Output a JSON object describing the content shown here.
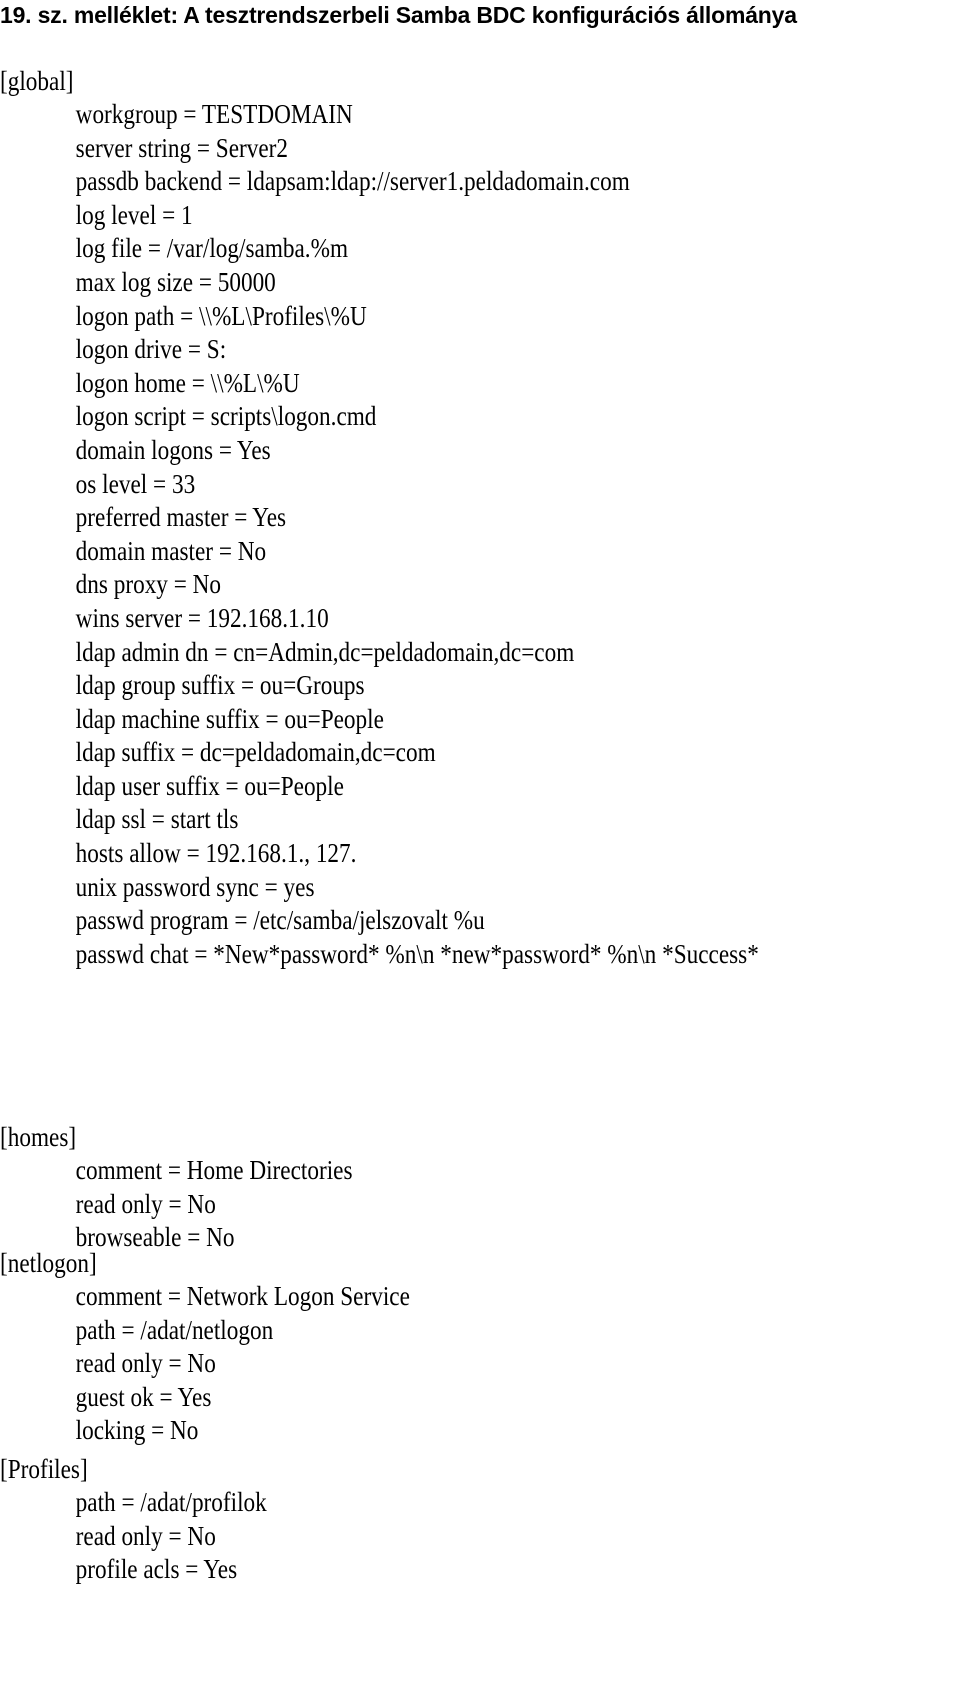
{
  "title": "19. sz. melléklet: A tesztrendszerbeli Samba BDC konfigurációs állománya",
  "sections": [
    {
      "header": "[global]",
      "entries": [
        "workgroup = TESTDOMAIN",
        "server string = Server2",
        "passdb backend = ldapsam:ldap://server1.peldadomain.com",
        "log level = 1",
        "log file = /var/log/samba.%m",
        "max log size = 50000",
        "logon path = \\\\%L\\Profiles\\%U",
        "logon drive = S:",
        "logon home = \\\\%L\\%U",
        "logon script = scripts\\logon.cmd",
        "domain logons = Yes",
        "os level = 33",
        "preferred master = Yes",
        "domain master = No",
        "dns proxy = No",
        "wins server = 192.168.1.10",
        "ldap admin dn = cn=Admin,dc=peldadomain,dc=com",
        "ldap group suffix = ou=Groups",
        "ldap machine suffix = ou=People",
        "ldap suffix = dc=peldadomain,dc=com",
        "ldap user suffix = ou=People",
        "ldap ssl = start tls",
        "hosts allow = 192.168.1., 127.",
        "unix password sync = yes",
        "passwd program = /etc/samba/jelszovalt %u",
        "passwd chat = *New*password* %n\\n *new*password* %n\\n *Success*"
      ]
    },
    {
      "header": "[homes]",
      "entries": [
        "comment = Home Directories",
        "read only = No",
        "browseable = No"
      ]
    },
    {
      "header": "[netlogon]",
      "entries": [
        "comment = Network Logon Service",
        "path = /adat/netlogon",
        "read only = No",
        "guest ok = Yes",
        "locking = No"
      ]
    },
    {
      "header": "[Profiles]",
      "entries": [
        "path = /adat/profilok",
        "read only = No",
        "profile acls = Yes"
      ]
    }
  ]
}
